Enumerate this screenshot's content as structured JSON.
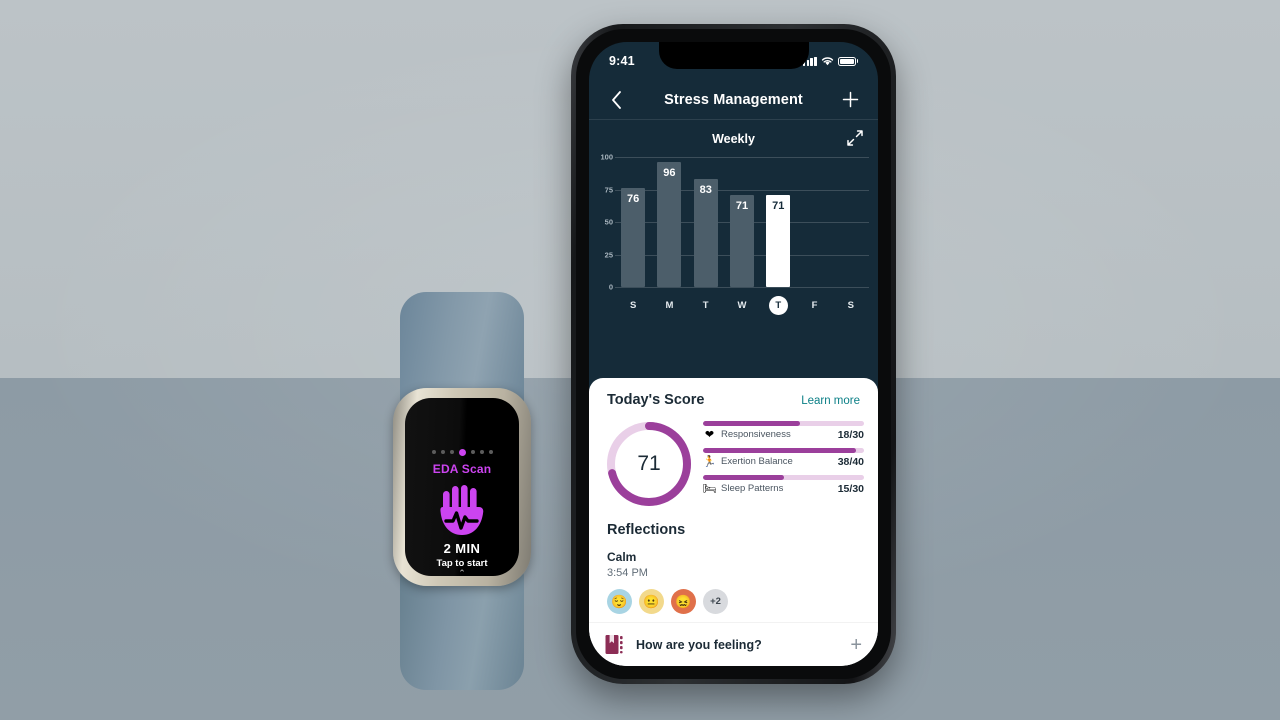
{
  "backdrop": {
    "top_color": "#bcc3c7",
    "bottom_color": "#8d9ba5"
  },
  "tracker": {
    "device_name": "fitness-tracker",
    "band_color": "#8399a9",
    "screen": {
      "accent_color": "#cc44f0",
      "page_dots": {
        "count": 7,
        "active_index": 3
      },
      "label": "EDA Scan",
      "icon": "hand-scan-icon",
      "duration": "2 MIN",
      "action_hint": "Tap to start",
      "chevron": "⌃"
    }
  },
  "phone": {
    "status_bar": {
      "time": "9:41",
      "icons": [
        "cellular-signal-icon",
        "wifi-icon",
        "battery-icon"
      ]
    },
    "nav": {
      "back_icon": "chevron-left-icon",
      "title": "Stress Management",
      "add_icon": "plus-icon"
    },
    "chart_card": {
      "title": "Weekly",
      "expand_icon": "expand-arrows-icon"
    },
    "today_score": {
      "title": "Today's Score",
      "learn_more": "Learn more",
      "learn_more_color": "#0b7f86",
      "score": "71",
      "ring_color": "#9b3f9b",
      "ring_track_color": "#e9cfe8",
      "metrics": [
        {
          "icon": "heart-icon",
          "glyph": "❤",
          "label": "Responsiveness",
          "value": "18/30",
          "current": 18,
          "max": 30
        },
        {
          "icon": "exertion-icon",
          "glyph": "🏃",
          "label": "Exertion Balance",
          "value": "38/40",
          "current": 38,
          "max": 40
        },
        {
          "icon": "bed-icon",
          "glyph": "🛏",
          "label": "Sleep Patterns",
          "value": "15/30",
          "current": 15,
          "max": 30
        }
      ]
    },
    "reflections": {
      "title": "Reflections",
      "mood": "Calm",
      "time": "3:54 PM",
      "chips": [
        {
          "name": "relaxed-face-chip",
          "glyph": "😌",
          "bg": "#a8d4e3"
        },
        {
          "name": "neutral-face-chip",
          "glyph": "😐",
          "bg": "#f2d98c"
        },
        {
          "name": "confounded-face-chip",
          "glyph": "😖",
          "bg": "#e0704a"
        },
        {
          "name": "more-chip",
          "glyph": "+2",
          "bg": "#d8dade"
        }
      ]
    },
    "feeling_bar": {
      "icon": "notebook-icon",
      "text": "How are you feeling?",
      "add_icon": "plus-icon"
    }
  },
  "chart_data": {
    "type": "bar",
    "title": "Weekly",
    "categories": [
      "S",
      "M",
      "T",
      "W",
      "T",
      "F",
      "S"
    ],
    "values": [
      76,
      96,
      83,
      71,
      71,
      null,
      null
    ],
    "labels": [
      "76",
      "96",
      "83",
      "71",
      "71",
      "",
      ""
    ],
    "highlight_index": 4,
    "selected_day_index": 4,
    "ylim": [
      0,
      100
    ],
    "yticks": [
      100,
      75,
      50,
      25,
      0
    ],
    "ytick_labels": [
      "100",
      "75",
      "50",
      "25",
      "0"
    ],
    "xlabel": "",
    "ylabel": "",
    "grid": true,
    "bar_color": "#4c5e6a",
    "highlight_bar_color": "#ffffff",
    "background": "#152b39"
  }
}
